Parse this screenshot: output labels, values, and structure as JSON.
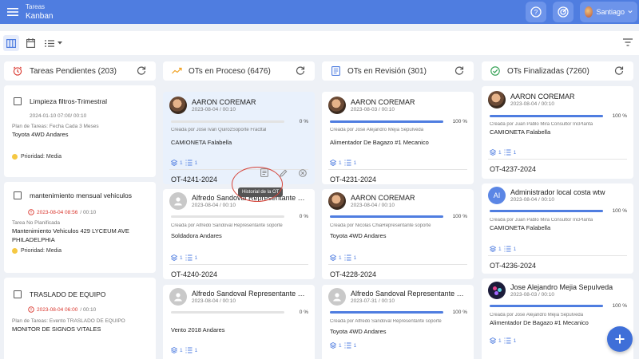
{
  "app": {
    "section": "Tareas",
    "title": "Kanban",
    "user_name": "Santiago",
    "accent": "#4f7de0"
  },
  "columns": {
    "pending": {
      "title": "Tareas Pendientes (203)"
    },
    "process": {
      "title": "OTs en Proceso (6476)"
    },
    "review": {
      "title": "OTs en Revisión (301)"
    },
    "done": {
      "title": "OTs Finalizadas (7260)"
    }
  },
  "tasks": [
    {
      "title": "Limpieza filtros-Trimestral",
      "date": "2024-01-10 07:00/ 00:10",
      "date_overdue": false,
      "plan": "Plan de Tareas: Fecha Cada 3 Meses",
      "target": "Toyota 4WD Andares",
      "priority": "Prioridad: Media"
    },
    {
      "title": "mantenimiento mensual vehiculos",
      "date_red": "2023-08-04 08:56",
      "date_gray": "/ 00:10",
      "plan": "Tarea No Planificada",
      "target": "Mantenimiento Vehiculos 429 LYCEUM AVE PHILADELPHIA",
      "priority": "Prioridad: Media"
    },
    {
      "title": "TRASLADO DE EQUIPO",
      "date_red": "2023-08-04 06:00",
      "date_gray": "/ 00:10",
      "plan": "Plan de Tareas: Evento TRASLADO DE EQUIPO",
      "target": "MONITOR DE SIGNOS VITALES"
    }
  ],
  "process_cards": [
    {
      "name": "AARON COREMAR",
      "date": "2023-08-04 / 00:10",
      "progress": 0,
      "pct": "0 %",
      "created": "Creada por Jose Ivan QuirozSoporte Fracttal",
      "target": "CAMIONETA Falabella",
      "c1": "1",
      "c2": "1",
      "code": "OT-4241-2024",
      "tooltip": "Historial de la OT"
    },
    {
      "name": "Alfredo Sandoval Representante soporte",
      "date": "2023-08-04 / 00:10",
      "progress": 0,
      "pct": "0 %",
      "created": "Creada por Alfredo Sandoval Representante soporte",
      "target": "Soldadora Andares",
      "c1": "1",
      "c2": "1",
      "code": "OT-4240-2024"
    },
    {
      "name": "Alfredo Sandoval Representante soporte",
      "date": "2023-08-04 / 00:10",
      "progress": 0,
      "pct": "0 %",
      "target": "Vento 2018 Andares",
      "c1": "1",
      "c2": "1"
    }
  ],
  "review_cards": [
    {
      "name": "AARON COREMAR",
      "date": "2023-08-03 / 00:10",
      "progress": 100,
      "pct": "100 %",
      "created": "Creada por Jose Alejandro Mejia Sepulveda",
      "target": "Alimentador De Bagazo #1 Mecanico",
      "c1": "1",
      "c2": "1",
      "code": "OT-4231-2024"
    },
    {
      "name": "AARON COREMAR",
      "date": "2023-08-04 / 00:10",
      "progress": 100,
      "pct": "100 %",
      "created": "Creada por Nicolas ChiaRepresentante soporte",
      "target": "Toyota 4WD Andares",
      "c1": "1",
      "c2": "1",
      "code": "OT-4228-2024"
    },
    {
      "name": "Alfredo Sandoval Representante soporte",
      "date": "2023-07-31 / 00:10",
      "progress": 100,
      "pct": "100 %",
      "created": "Creada por Alfredo Sandoval Representante soporte",
      "target": "Toyota 4WD Andares",
      "c1": "1",
      "c2": "1"
    }
  ],
  "done_cards": [
    {
      "name": "AARON COREMAR",
      "date": "2023-08-04 / 00:10",
      "progress": 100,
      "pct": "100 %",
      "created": "Creada por Juan Pablo Mira Consultor IncPlanta",
      "target": "CAMIONETA Falabella",
      "c1": "1",
      "c2": "1",
      "code": "OT-4237-2024"
    },
    {
      "name": "Administrador local costa wtw",
      "initials": "AI",
      "date": "2023-08-04 / 00:10",
      "progress": 100,
      "pct": "100 %",
      "created": "Creada por Juan Pablo Mira Consultor IncPlanta",
      "target": "CAMIONETA Falabella",
      "c1": "1",
      "c2": "1",
      "code": "OT-4236-2024"
    },
    {
      "name": "Jose Alejandro Mejia Sepulveda",
      "date": "2023-08-03 / 00:10",
      "progress": 100,
      "pct": "100 %",
      "created": "Creada por Jose Alejandro Mejia Sepulveda",
      "target": "Alimentador De Bagazo #1 Mecanico",
      "c1": "1",
      "c2": "1"
    }
  ]
}
